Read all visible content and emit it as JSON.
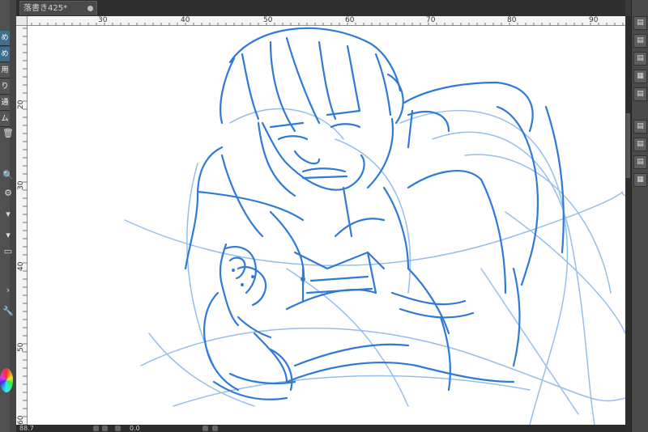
{
  "tab": {
    "title": "落書き425*"
  },
  "left_panel": {
    "items": [
      "め",
      "め",
      "用",
      "り",
      "通",
      "ム"
    ],
    "icons": [
      "bucket-icon",
      "zoom-icon",
      "gear-icon",
      "dropdown-icon",
      "dropdown-icon",
      "rectangle-icon",
      "chevron-icon",
      "wrench-icon"
    ]
  },
  "ruler": {
    "top_labels": [
      "30",
      "40",
      "50",
      "60",
      "70",
      "80",
      "90"
    ],
    "left_labels": [
      "20",
      "30",
      "40",
      "50",
      "60"
    ]
  },
  "status": {
    "zoom": "88.7",
    "rotation": "0.0"
  },
  "colors": {
    "sketch": "#2f7ad6",
    "sketch_light": "#8ab8ec",
    "canvas": "#ffffff"
  }
}
